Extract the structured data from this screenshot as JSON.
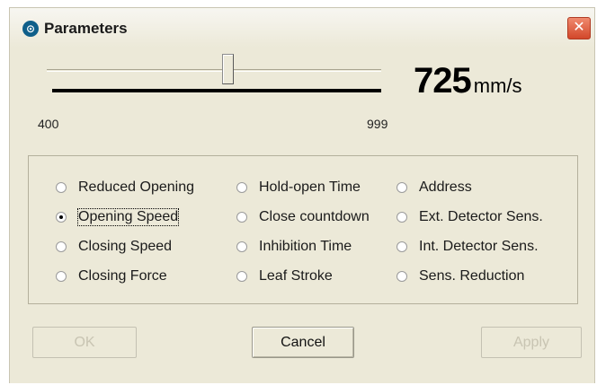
{
  "window": {
    "title": "Parameters",
    "close_glyph": "✕"
  },
  "slider": {
    "min_label": "400",
    "max_label": "999",
    "min": 400,
    "max": 999,
    "value": 725
  },
  "readout": {
    "value": "725",
    "unit": "mm/s"
  },
  "options": [
    {
      "label": "Reduced Opening",
      "checked": false
    },
    {
      "label": "Opening Speed",
      "checked": true
    },
    {
      "label": "Closing Speed",
      "checked": false
    },
    {
      "label": "Closing Force",
      "checked": false
    },
    {
      "label": "Hold-open Time",
      "checked": false
    },
    {
      "label": "Close countdown",
      "checked": false
    },
    {
      "label": "Inhibition Time",
      "checked": false
    },
    {
      "label": "Leaf Stroke",
      "checked": false
    },
    {
      "label": "Address",
      "checked": false
    },
    {
      "label": "Ext. Detector Sens.",
      "checked": false
    },
    {
      "label": "Int. Detector Sens.",
      "checked": false
    },
    {
      "label": "Sens. Reduction",
      "checked": false
    }
  ],
  "buttons": {
    "ok": "OK",
    "cancel": "Cancel",
    "apply": "Apply"
  }
}
